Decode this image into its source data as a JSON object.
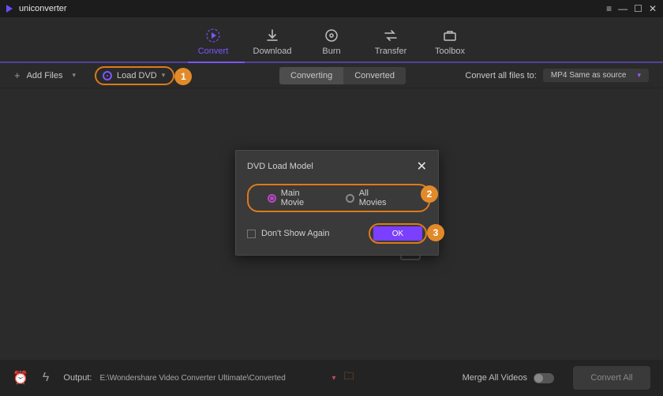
{
  "titlebar": {
    "brand": "uniconverter"
  },
  "nav": {
    "convert": "Convert",
    "download": "Download",
    "burn": "Burn",
    "transfer": "Transfer",
    "toolbox": "Toolbox"
  },
  "subbar": {
    "add_files": "Add Files",
    "load_dvd": "Load DVD",
    "converting_tab": "Converting",
    "converted_tab": "Converted",
    "convert_all_label": "Convert all files to:",
    "format_selected": "MP4 Same as source"
  },
  "highlight": {
    "n1": "1",
    "n2": "2",
    "n3": "3"
  },
  "dialog": {
    "title": "DVD Load Model",
    "opt_main": "Main Movie",
    "opt_all": "All Movies",
    "dont_show": "Don't Show Again",
    "ok": "OK"
  },
  "bottom": {
    "output_label": "Output:",
    "output_path": "E:\\Wondershare Video Converter Ultimate\\Converted",
    "merge_label": "Merge All Videos",
    "convert_all_btn": "Convert All"
  }
}
